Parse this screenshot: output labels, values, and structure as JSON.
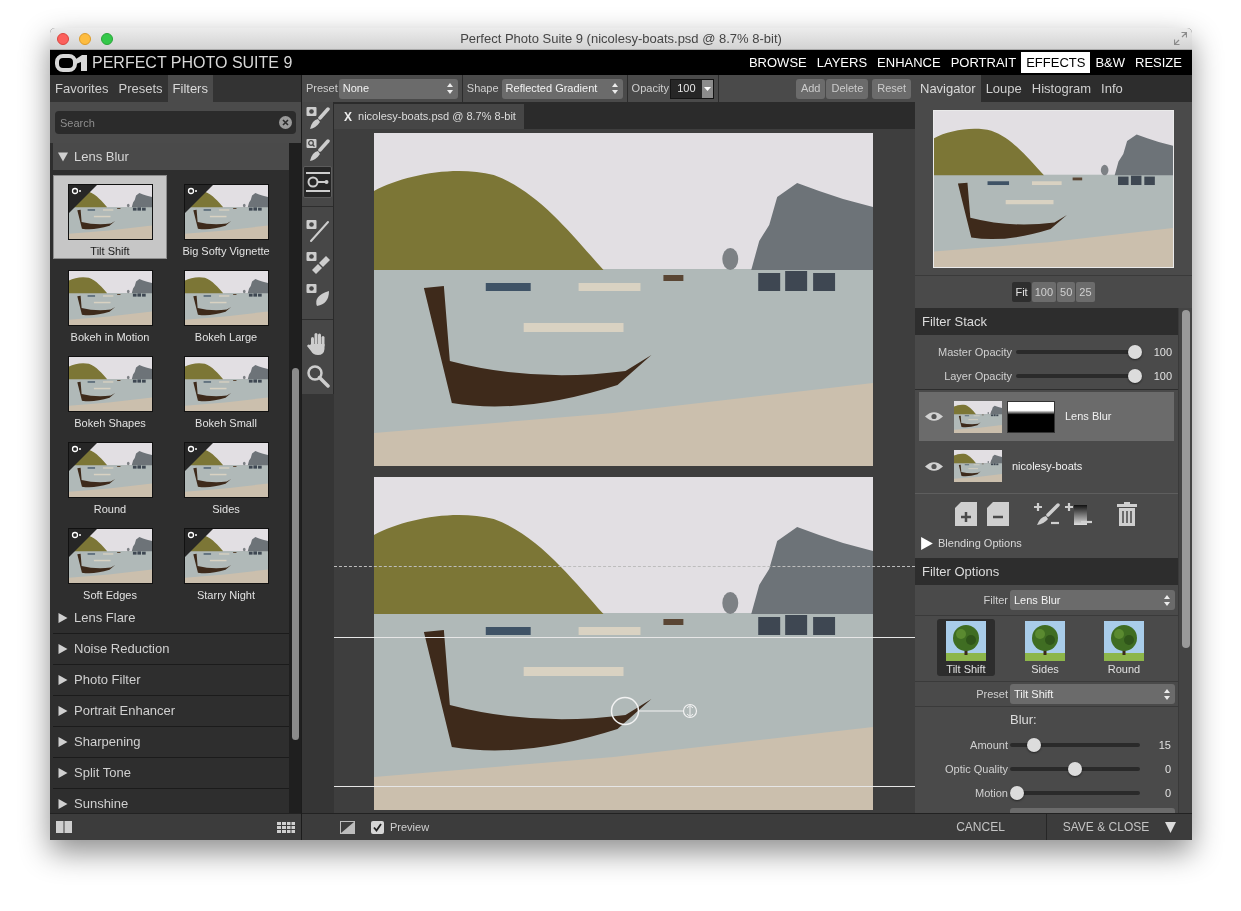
{
  "window": {
    "title": "Perfect Photo Suite 9 (nicolesy-boats.psd @ 8.7% 8-bit)"
  },
  "app_header": {
    "title": "PERFECT PHOTO SUITE 9",
    "modules": [
      {
        "label": "BROWSE",
        "selected": false
      },
      {
        "label": "LAYERS",
        "selected": false
      },
      {
        "label": "ENHANCE",
        "selected": false
      },
      {
        "label": "PORTRAIT",
        "selected": false
      },
      {
        "label": "EFFECTS",
        "selected": true
      },
      {
        "label": "B&W",
        "selected": false
      },
      {
        "label": "RESIZE",
        "selected": false
      }
    ]
  },
  "left_panel": {
    "tabs": [
      {
        "label": "Favorites",
        "selected": false
      },
      {
        "label": "Presets",
        "selected": false
      },
      {
        "label": "Filters",
        "selected": true
      }
    ],
    "search": {
      "placeholder": "Search"
    },
    "filter_groups": [
      {
        "label": "Lens Blur",
        "expanded": true,
        "presets": [
          {
            "label": "Tilt Shift",
            "selected": true,
            "badge": true
          },
          {
            "label": "Big Softy Vignette",
            "selected": false,
            "badge": true
          },
          {
            "label": "Bokeh in Motion",
            "selected": false,
            "badge": false
          },
          {
            "label": "Bokeh Large",
            "selected": false,
            "badge": false
          },
          {
            "label": "Bokeh Shapes",
            "selected": false,
            "badge": false
          },
          {
            "label": "Bokeh Small",
            "selected": false,
            "badge": false
          },
          {
            "label": "Round",
            "selected": false,
            "badge": true
          },
          {
            "label": "Sides",
            "selected": false,
            "badge": true
          },
          {
            "label": "Soft Edges",
            "selected": false,
            "badge": true
          },
          {
            "label": "Starry Night",
            "selected": false,
            "badge": true
          }
        ]
      },
      {
        "label": "Lens Flare",
        "expanded": false
      },
      {
        "label": "Noise Reduction",
        "expanded": false
      },
      {
        "label": "Photo Filter",
        "expanded": false
      },
      {
        "label": "Portrait Enhancer",
        "expanded": false
      },
      {
        "label": "Sharpening",
        "expanded": false
      },
      {
        "label": "Split Tone",
        "expanded": false
      },
      {
        "label": "Sunshine",
        "expanded": false
      }
    ]
  },
  "toolbar": {
    "preset": {
      "label": "Preset",
      "value": "None"
    },
    "shape": {
      "label": "Shape",
      "value": "Reflected Gradient"
    },
    "opacity": {
      "label": "Opacity",
      "value": "100"
    },
    "buttons": [
      {
        "label": "Add"
      },
      {
        "label": "Delete"
      },
      {
        "label": "Reset"
      }
    ]
  },
  "tool_groups": [
    {
      "tools": [
        {
          "kind": "brush",
          "selected": false
        },
        {
          "kind": "refine",
          "selected": false
        },
        {
          "kind": "gradient",
          "selected": true
        }
      ]
    },
    {
      "tools": [
        {
          "kind": "pen",
          "selected": false
        },
        {
          "kind": "eraser",
          "selected": false
        },
        {
          "kind": "chisel",
          "selected": false
        }
      ]
    },
    {
      "tools": [
        {
          "kind": "hand",
          "selected": false
        },
        {
          "kind": "zoom",
          "selected": false
        }
      ]
    }
  ],
  "document": {
    "tab": {
      "close": "X",
      "title": "nicolesy-boats.psd @ 8.7% 8-bit"
    }
  },
  "preview_bar": {
    "preview": {
      "label": "Preview",
      "checked": true
    }
  },
  "right_panel": {
    "tabs": [
      {
        "label": "Navigator",
        "selected": true
      },
      {
        "label": "Loupe",
        "selected": false
      },
      {
        "label": "Histogram",
        "selected": false
      },
      {
        "label": "Info",
        "selected": false
      }
    ],
    "zoom_levels": [
      {
        "label": "Fit",
        "selected": true
      },
      {
        "label": "100",
        "selected": false
      },
      {
        "label": "50",
        "selected": false
      },
      {
        "label": "25",
        "selected": false
      }
    ],
    "filter_stack": {
      "title": "Filter Stack",
      "sliders": [
        {
          "label": "Master Opacity",
          "level": 1,
          "reading": "100"
        },
        {
          "label": "Layer Opacity",
          "level": 1,
          "reading": "100"
        }
      ],
      "layers": [
        {
          "name": "Lens Blur",
          "selected": true,
          "visible": true,
          "has_mask": true
        },
        {
          "name": "nicolesy-boats",
          "selected": false,
          "visible": true,
          "has_mask": false
        }
      ],
      "blending_options": {
        "label": "Blending Options",
        "expanded": false
      }
    },
    "filter_options": {
      "title": "Filter Options",
      "filter": {
        "label": "Filter",
        "value": "Lens Blur"
      },
      "types": [
        {
          "label": "Tilt Shift",
          "selected": true
        },
        {
          "label": "Sides",
          "selected": false
        },
        {
          "label": "Round",
          "selected": false
        }
      ],
      "preset": {
        "label": "Preset",
        "value": "Tilt Shift"
      },
      "section": "Blur:",
      "sliders": [
        {
          "label": "Amount",
          "level": 0.15,
          "reading": "15"
        },
        {
          "label": "Optic Quality",
          "level": 0.5,
          "reading": "0"
        },
        {
          "label": "Motion",
          "level": 0,
          "reading": "0"
        }
      ]
    }
  },
  "actions": [
    {
      "label": "CANCEL",
      "has_menu": false
    },
    {
      "label": "SAVE & CLOSE",
      "has_menu": true
    }
  ]
}
